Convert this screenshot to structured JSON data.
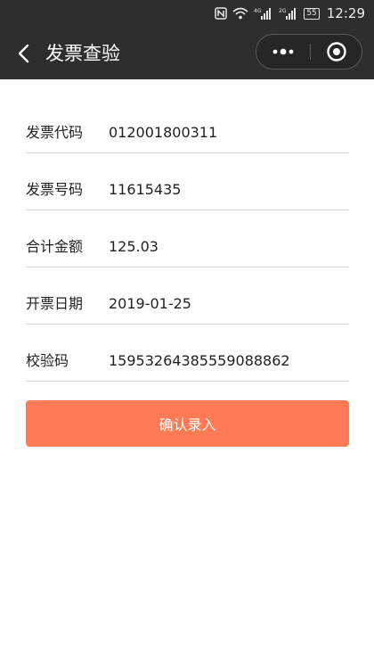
{
  "status_bar": {
    "network_4g": "4G",
    "network_2g": "2G",
    "battery": "55",
    "time": "12:29"
  },
  "nav": {
    "title": "发票查验"
  },
  "form": {
    "rows": [
      {
        "label": "发票代码",
        "value": "012001800311"
      },
      {
        "label": "发票号码",
        "value": "11615435"
      },
      {
        "label": "合计金额",
        "value": "125.03"
      },
      {
        "label": "开票日期",
        "value": "2019-01-25"
      },
      {
        "label": "校验码",
        "value": "15953264385559088862"
      }
    ]
  },
  "submit": {
    "label": "确认录入"
  },
  "colors": {
    "header_bg": "#2e2e2e",
    "accent_button": "#ff7a55"
  },
  "icons": {
    "back": "chevron-left-icon",
    "more": "more-dots-icon",
    "close": "target-circle-icon"
  }
}
